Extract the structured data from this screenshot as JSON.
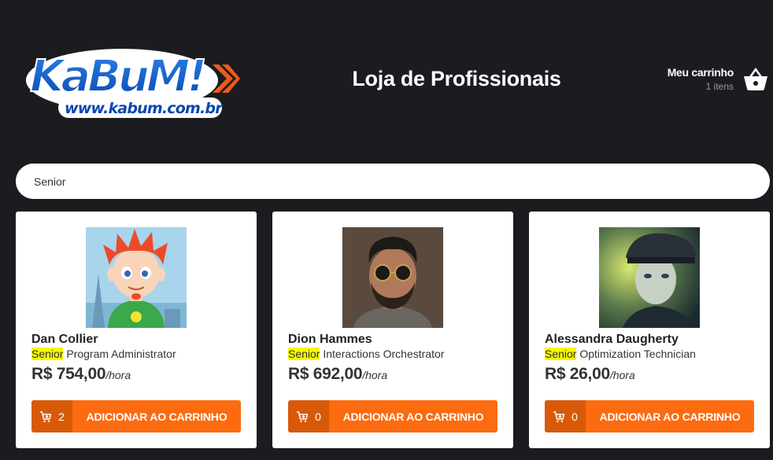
{
  "header": {
    "logo_text": "KaBuM!",
    "logo_url_text": "www.kabum.com.br",
    "title": "Loja de Profissionais",
    "cart": {
      "label": "Meu carrinho",
      "count": "1 itens"
    }
  },
  "search": {
    "value": "Senior",
    "placeholder": ""
  },
  "colors": {
    "background": "#1b1c20",
    "accent": "#fc6b0f",
    "accent_dark": "#d85a09",
    "highlight": "#f8f800",
    "logo_blue": "#1060c8"
  },
  "products": [
    {
      "name": "Dan Collier",
      "highlight": "Senior",
      "role_rest": " Program Administrator",
      "price": "R$ 754,00",
      "unit": "/hora",
      "qty": "2",
      "button_label": "ADICIONAR AO CARRINHO",
      "icon": "cart-plus-icon"
    },
    {
      "name": "Dion Hammes",
      "highlight": "Senior",
      "role_rest": " Interactions Orchestrator",
      "price": "R$ 692,00",
      "unit": "/hora",
      "qty": "0",
      "button_label": "ADICIONAR AO CARRINHO",
      "icon": "cart-plus-icon"
    },
    {
      "name": "Alessandra Daugherty",
      "highlight": "Senior",
      "role_rest": " Optimization Technician",
      "price": "R$ 26,00",
      "unit": "/hora",
      "qty": "0",
      "button_label": "ADICIONAR AO CARRINHO",
      "icon": "cart-plus-icon"
    }
  ]
}
